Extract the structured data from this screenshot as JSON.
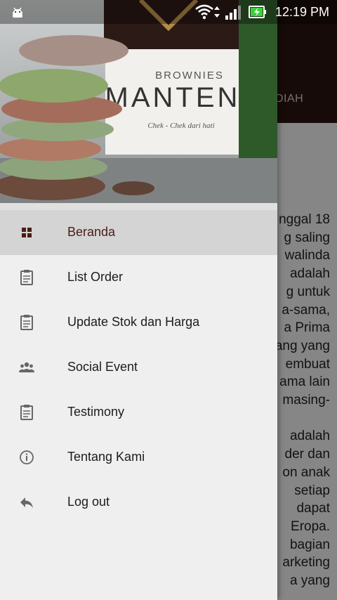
{
  "status_bar": {
    "time": "12:19 PM"
  },
  "background_app": {
    "tab_label": "DIAH",
    "text_lines": [
      "nggal 18",
      "g saling",
      "walinda",
      "adalah",
      "g untuk",
      "a-sama,",
      "a Prima",
      "ang yang",
      "embuat",
      "ama lain",
      "masing-",
      "",
      "adalah",
      "der dan",
      "on anak",
      "setiap",
      "dapat",
      "Eropa.",
      "bagian",
      "arketing",
      "a yang"
    ]
  },
  "drawer": {
    "header_image": {
      "brand_line1": "BROWNIES",
      "brand_line2": "MANTEN",
      "tagline": "Chek - Chek dari hati"
    },
    "menu": [
      {
        "label": "Beranda",
        "icon": "dashboard-icon",
        "selected": true
      },
      {
        "label": "List Order",
        "icon": "clipboard-icon",
        "selected": false
      },
      {
        "label": "Update Stok dan Harga",
        "icon": "clipboard-icon",
        "selected": false
      },
      {
        "label": "Social Event",
        "icon": "group-icon",
        "selected": false
      },
      {
        "label": "Testimony",
        "icon": "clipboard-icon",
        "selected": false
      },
      {
        "label": "Tentang Kami",
        "icon": "info-icon",
        "selected": false
      },
      {
        "label": "Log out",
        "icon": "reply-icon",
        "selected": false
      }
    ]
  },
  "colors": {
    "accent": "#4a1d16",
    "selected_bg": "#d4d4d4",
    "drawer_bg": "#efefef",
    "icon_grey": "#666666"
  }
}
